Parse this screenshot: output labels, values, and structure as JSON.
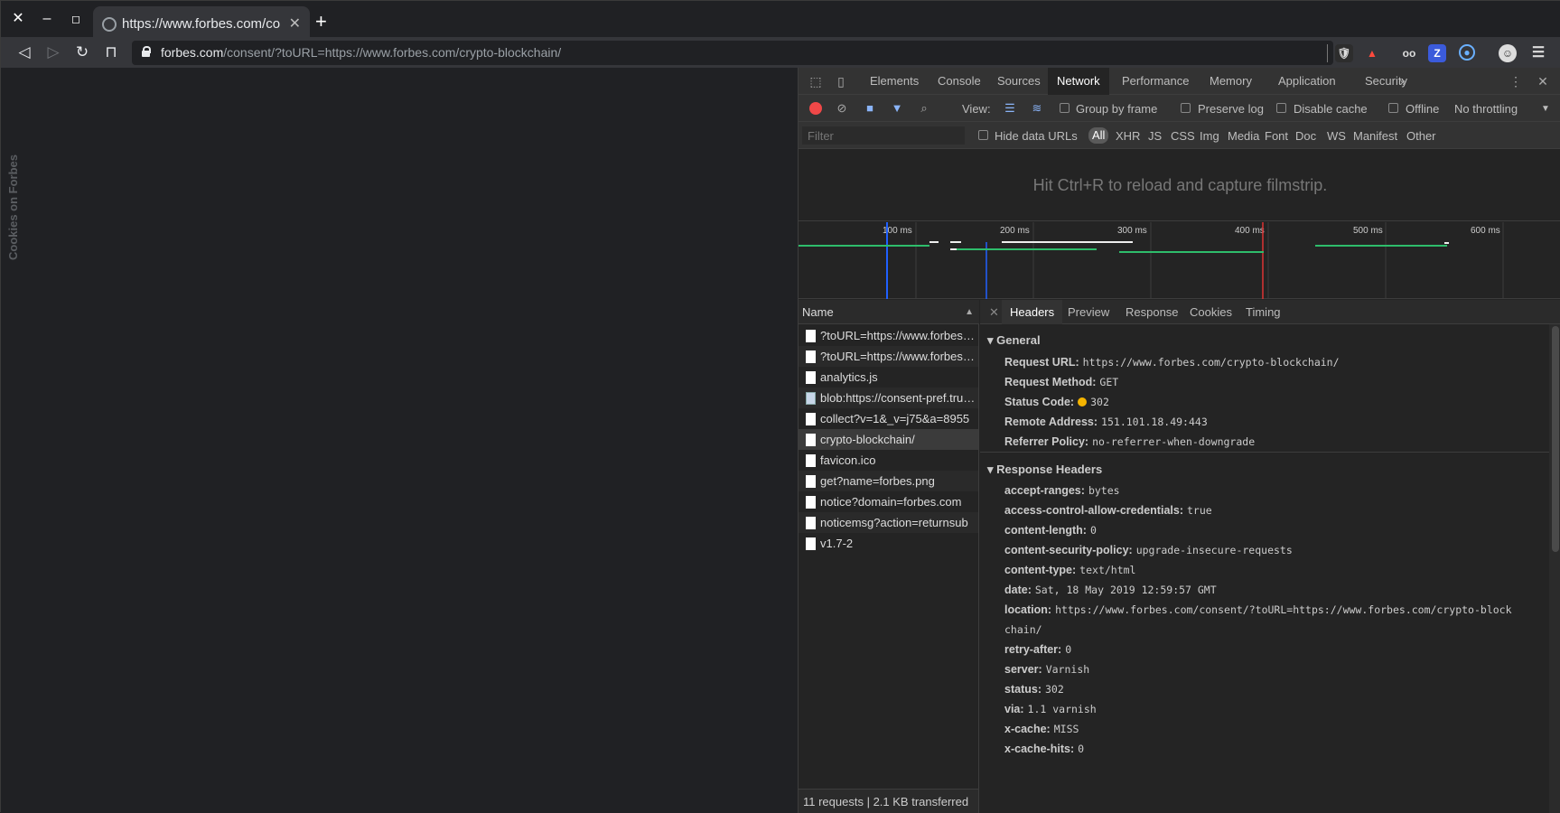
{
  "browser": {
    "tab_title": "https://www.forbes.com/co",
    "url_host": "forbes.com",
    "url_path": "/consent/?toURL=https://www.forbes.com/crypto-blockchain/"
  },
  "page": {
    "vertical_text": "Cookies on Forbes"
  },
  "devtools": {
    "tabs": [
      "Elements",
      "Console",
      "Sources",
      "Network",
      "Performance",
      "Memory",
      "Application",
      "Security"
    ],
    "active_tab": "Network",
    "toolbar": {
      "view_label": "View:",
      "group_by_frame": "Group by frame",
      "preserve_log": "Preserve log",
      "disable_cache": "Disable cache",
      "offline": "Offline",
      "throttling": "No throttling"
    },
    "filter": {
      "placeholder": "Filter",
      "hide_data_urls": "Hide data URLs",
      "types": [
        "All",
        "XHR",
        "JS",
        "CSS",
        "Img",
        "Media",
        "Font",
        "Doc",
        "WS",
        "Manifest",
        "Other"
      ]
    },
    "filmstrip_message": "Hit Ctrl+R to reload and capture filmstrip.",
    "timeline": {
      "ticks": [
        "100 ms",
        "200 ms",
        "300 ms",
        "400 ms",
        "500 ms",
        "600 ms"
      ]
    },
    "name_header": "Name",
    "requests": [
      {
        "name": "?toURL=https://www.forbes.com/crypto-blockchain/",
        "icon": "doc"
      },
      {
        "name": "?toURL=https://www.forbes.com/crypto-blockchain/",
        "icon": "doc"
      },
      {
        "name": "analytics.js",
        "icon": "doc"
      },
      {
        "name": "blob:https://consent-pref.trustarc.com",
        "icon": "img"
      },
      {
        "name": "collect?v=1&_v=j75&a=8955",
        "icon": "doc"
      },
      {
        "name": "crypto-blockchain/",
        "icon": "doc"
      },
      {
        "name": "favicon.ico",
        "icon": "doc"
      },
      {
        "name": "get?name=forbes.png",
        "icon": "doc"
      },
      {
        "name": "notice?domain=forbes.com",
        "icon": "doc"
      },
      {
        "name": "noticemsg?action=returnsub",
        "icon": "doc"
      },
      {
        "name": "v1.7-2",
        "icon": "doc"
      }
    ],
    "selected_request": 5,
    "status_summary": "11 requests  |  2.1 KB transferred",
    "detail_tabs": [
      "Headers",
      "Preview",
      "Response",
      "Cookies",
      "Timing"
    ],
    "active_detail_tab": "Headers",
    "general": {
      "title": "General",
      "rows": [
        {
          "k": "Request URL:",
          "v": "https://www.forbes.com/crypto-blockchain/"
        },
        {
          "k": "Request Method:",
          "v": "GET"
        },
        {
          "k": "Status Code:",
          "v": "302"
        },
        {
          "k": "Remote Address:",
          "v": "151.101.18.49:443"
        },
        {
          "k": "Referrer Policy:",
          "v": "no-referrer-when-downgrade"
        }
      ]
    },
    "response_headers": {
      "title": "Response Headers",
      "rows": [
        {
          "k": "accept-ranges:",
          "v": "bytes"
        },
        {
          "k": "access-control-allow-credentials:",
          "v": "true"
        },
        {
          "k": "content-length:",
          "v": "0"
        },
        {
          "k": "content-security-policy:",
          "v": "upgrade-insecure-requests"
        },
        {
          "k": "content-type:",
          "v": "text/html"
        },
        {
          "k": "date:",
          "v": "Sat, 18 May 2019 12:59:57 GMT"
        },
        {
          "k": "location:",
          "v": "https://www.forbes.com/consent/?toURL=https://www.forbes.com/crypto-block"
        },
        {
          "k": "",
          "v": "chain/"
        },
        {
          "k": "retry-after:",
          "v": "0"
        },
        {
          "k": "server:",
          "v": "Varnish"
        },
        {
          "k": "status:",
          "v": "302"
        },
        {
          "k": "via:",
          "v": "1.1 varnish"
        },
        {
          "k": "x-cache:",
          "v": "MISS"
        },
        {
          "k": "x-cache-hits:",
          "v": "0"
        }
      ]
    }
  }
}
